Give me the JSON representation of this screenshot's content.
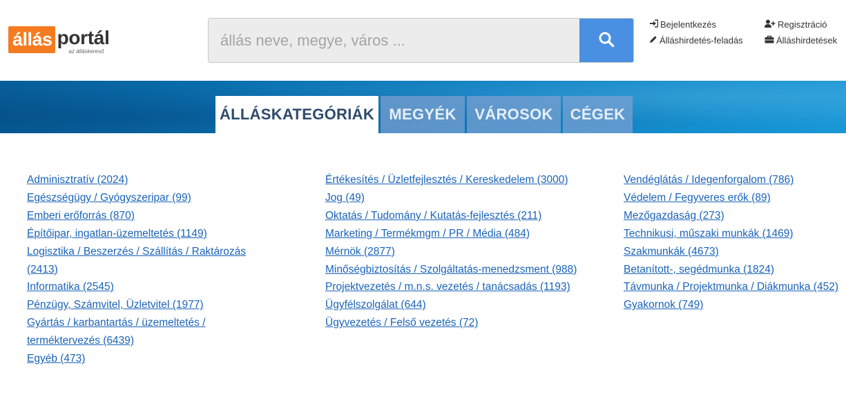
{
  "logo": {
    "part1": "állás",
    "part2": "portál",
    "tagline": "az álláskereső"
  },
  "search": {
    "placeholder": "állás neve, megye, város ..."
  },
  "toplinks": {
    "login": "Bejelentkezés",
    "register": "Regisztráció",
    "post_job": "Álláshirdetés-feladás",
    "job_ads": "Álláshirdetések"
  },
  "tabs": [
    "ÁLLÁSKATEGÓRIÁK",
    "MEGYÉK",
    "VÁROSOK",
    "CÉGEK"
  ],
  "categories": {
    "col1": [
      "Adminisztratív (2024)",
      "Egészségügy / Gyógyszeripar (99)",
      "Emberi erőforrás (870)",
      "Építőipar, ingatlan-üzemeltetés (1149)",
      "Logisztika / Beszerzés / Szállítás / Raktározás (2413)",
      "Informatika (2545)",
      "Pénzügy, Számvitel, Üzletvitel (1977)",
      "Gyártás / karbantartás / üzemeltetés / terméktervezés (6439)",
      "Egyéb (473)"
    ],
    "col2": [
      "Értékesítés / Üzletfejlesztés / Kereskedelem (3000)",
      "Jog (49)",
      "Oktatás / Tudomány / Kutatás-fejlesztés (211)",
      "Marketing / Termékmgm / PR / Média (484)",
      "Mérnök (2877)",
      "Minőségbiztosítás / Szolgáltatás-menedzsment (988)",
      "Projektvezetés / m.n.s. vezetés / tanácsadás (1193)",
      "Ügyfélszolgálat (644)",
      "Ügyvezetés / Felső vezetés (72)"
    ],
    "col3": [
      "Vendéglátás / Idegenforgalom (786)",
      "Védelem / Fegyveres erők (89)",
      "Mezőgazdaság (273)",
      "Technikusi, műszaki munkák (1469)",
      "Szakmunkák (4673)",
      "Betanított-, segédmunka (1824)",
      "Távmunka / Projektmunka / Diákmunka (452)",
      "Gyakornok (749)"
    ]
  },
  "colors": {
    "brand_orange": "#f47b20",
    "accent_blue": "#4a90e2",
    "link": "#1a63b8",
    "tab_active_text": "#2d4a6a"
  },
  "icons": {
    "search": "search-icon",
    "login": "sign-in-icon",
    "register": "user-plus-icon",
    "post_job": "pencil-icon",
    "job_ads": "briefcase-icon"
  }
}
